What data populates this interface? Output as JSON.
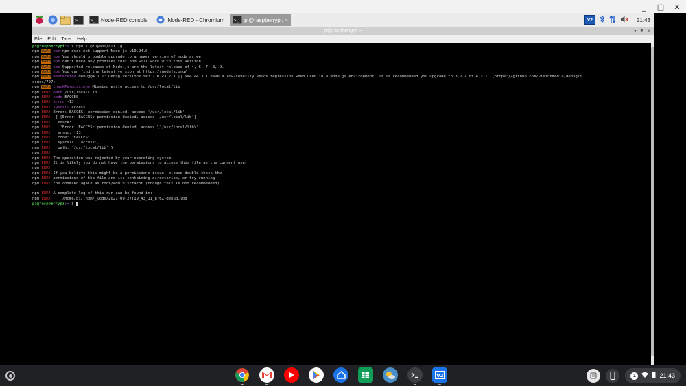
{
  "window": {
    "minimize_glyph": "_",
    "maximize_glyph": "□",
    "close_glyph": "✕"
  },
  "pi_panel": {
    "tasks": [
      {
        "label": "Node-RED console",
        "active": false,
        "icon": "terminal-icon"
      },
      {
        "label": "Node-RED - Chromium",
        "active": false,
        "icon": "chromium-icon"
      },
      {
        "label": "pi@raspberrypi: ~",
        "active": true,
        "icon": "terminal-icon"
      }
    ],
    "vnc_label": "V2",
    "clock": "21:43"
  },
  "terminal": {
    "title": "pi@raspberrypi: ~",
    "menu": [
      "File",
      "Edit",
      "Tabs",
      "Help"
    ],
    "lines": [
      {
        "kind": "prompt",
        "cmd": "npm i @tuyapi/cli -g"
      },
      {
        "kind": "warn",
        "sub": "npm",
        "text": "npm does not support Node.js v10.24.0"
      },
      {
        "kind": "warn",
        "sub": "npm",
        "text": "You should probably upgrade to a newer version of node as we"
      },
      {
        "kind": "warn",
        "sub": "npm",
        "text": "can't make any promises that npm will work with this version."
      },
      {
        "kind": "warn",
        "sub": "npm",
        "text": "Supported releases of Node.js are the latest release of 4, 6, 7, 8, 9."
      },
      {
        "kind": "warn",
        "sub": "npm",
        "text": "You can find the latest version at https://nodejs.org/"
      },
      {
        "kind": "warn",
        "sub": "deprecated",
        "text": "debug@4.1.1: Debug versions >=3.2.0 <3.2.7 || >=4 <4.3.1 have a low-severity ReDos regression when used in a Node.js environment. It is recommended you upgrade to 3.2.7 or 4.3.1. (https://github.com/visionmedia/debug/i"
      },
      {
        "kind": "plain",
        "text": "ssues/797)"
      },
      {
        "kind": "warn",
        "sub": "checkPermissions",
        "text": "Missing write access to /usr/local/lib"
      },
      {
        "kind": "err",
        "sub": "path",
        "text": "/usr/local/lib"
      },
      {
        "kind": "err",
        "sub": "code",
        "text": "EACCES"
      },
      {
        "kind": "err",
        "sub": "errno",
        "text": "-13"
      },
      {
        "kind": "err",
        "sub": "syscall",
        "text": "access"
      },
      {
        "kind": "err",
        "sub": "",
        "text": "Error: EACCES: permission denied, access '/usr/local/lib'"
      },
      {
        "kind": "err",
        "sub": "",
        "text": " { [Error: EACCES: permission denied, access '/usr/local/lib']"
      },
      {
        "kind": "err",
        "sub": "",
        "text": "  stack:"
      },
      {
        "kind": "err",
        "sub": "",
        "text": "   'Error: EACCES: permission denied, access \\'/usr/local/lib\\'',"
      },
      {
        "kind": "err",
        "sub": "",
        "text": "  errno: -13,"
      },
      {
        "kind": "err",
        "sub": "",
        "text": "  code: 'EACCES',"
      },
      {
        "kind": "err",
        "sub": "",
        "text": "  syscall: 'access',"
      },
      {
        "kind": "err",
        "sub": "",
        "text": "  path: '/usr/local/lib' }"
      },
      {
        "kind": "err",
        "sub": "",
        "text": ""
      },
      {
        "kind": "err",
        "sub": "",
        "text": "The operation was rejected by your operating system."
      },
      {
        "kind": "err",
        "sub": "",
        "text": "It is likely you do not have the permissions to access this file as the current user"
      },
      {
        "kind": "err",
        "sub": "",
        "text": ""
      },
      {
        "kind": "err",
        "sub": "",
        "text": "If you believe this might be a permissions issue, please double-check the"
      },
      {
        "kind": "err",
        "sub": "",
        "text": "permissions of the file and its containing directories, or try running"
      },
      {
        "kind": "err",
        "sub": "",
        "text": "the command again as root/Administrator (though this is not recommended)."
      },
      {
        "kind": "blank",
        "text": ""
      },
      {
        "kind": "err",
        "sub": "",
        "text": "A complete log of this run can be found in:"
      },
      {
        "kind": "err",
        "sub": "",
        "text": "    /home/pi/.npm/_logs/2021-09-27T19_43_11_876Z-debug.log"
      },
      {
        "kind": "prompt",
        "cmd": ""
      }
    ],
    "prompt_user": "pi@raspberrypi",
    "prompt_path": "~",
    "npm_word": "npm",
    "warn_tag": "WARN",
    "err_tag": "ERR!"
  },
  "shelf": {
    "clock": "21:43",
    "notification_count": "1",
    "apps": [
      {
        "name": "chrome-icon",
        "color": "#ea4335"
      },
      {
        "name": "gmail-icon",
        "color": "#ffffff"
      },
      {
        "name": "youtube-icon",
        "color": "#ff0000"
      },
      {
        "name": "play-store-icon",
        "color": "#ffffff"
      },
      {
        "name": "home-app-icon",
        "color": "#1a73e8"
      },
      {
        "name": "sheets-icon",
        "color": "#0f9d58"
      },
      {
        "name": "weather-icon",
        "color": "#f9ab00"
      },
      {
        "name": "terminal-icon",
        "color": "#3c4043"
      },
      {
        "name": "vnc-viewer-icon",
        "color": "#1a73e8"
      }
    ]
  }
}
